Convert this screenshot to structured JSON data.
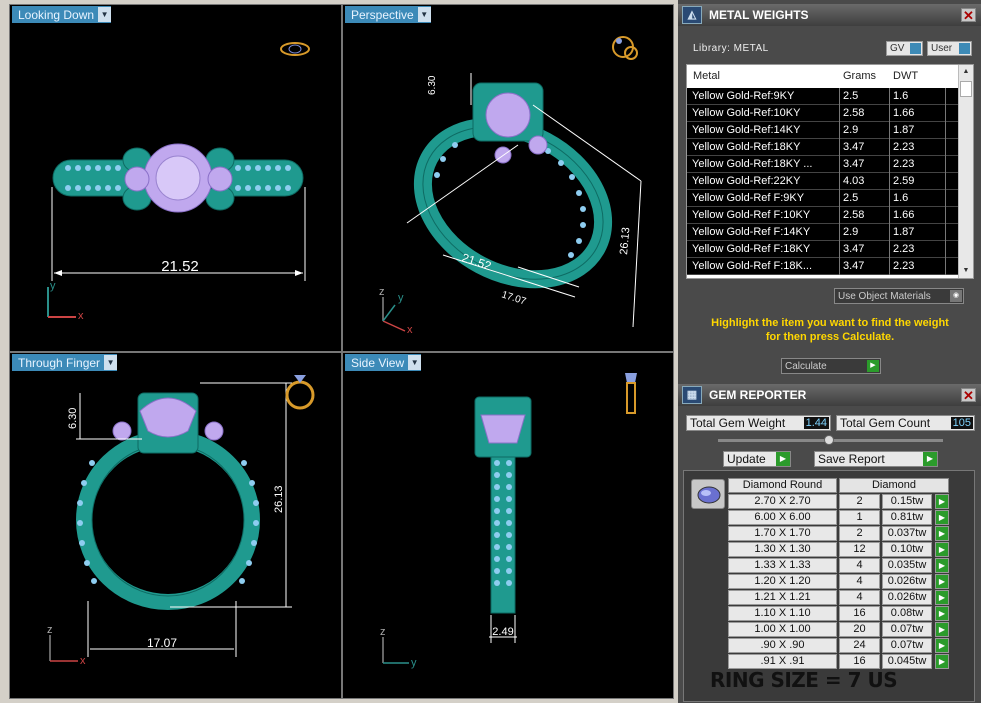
{
  "viewports": {
    "looking_down": {
      "label": "Looking Down",
      "dim_width": "21.52",
      "axis_v": "y",
      "axis_h": "x"
    },
    "perspective": {
      "label": "Perspective",
      "dim_top": "6.30",
      "dim_width": "21.52",
      "dim_height": "26.13",
      "dim_inner": "17.07",
      "axis_v": "z",
      "axis_d": "y",
      "axis_h": "x"
    },
    "through_finger": {
      "label": "Through Finger",
      "dim_top": "6.30",
      "dim_height": "26.13",
      "dim_inner": "17.07",
      "axis_v": "z",
      "axis_h": "x"
    },
    "side_view": {
      "label": "Side View",
      "dim_shank": "2.49",
      "axis_v": "z",
      "axis_h": "y"
    }
  },
  "metal_weights": {
    "title": "METAL WEIGHTS",
    "library_label": "Library: METAL",
    "toggle_gv": "GV",
    "toggle_user": "User",
    "columns": [
      "Metal",
      "Grams",
      "DWT"
    ],
    "rows": [
      [
        "Yellow Gold-Ref:9KY",
        "2.5",
        "1.6"
      ],
      [
        "Yellow Gold-Ref:10KY",
        "2.58",
        "1.66"
      ],
      [
        "Yellow Gold-Ref:14KY",
        "2.9",
        "1.87"
      ],
      [
        "Yellow Gold-Ref:18KY",
        "3.47",
        "2.23"
      ],
      [
        "Yellow Gold-Ref:18KY ...",
        "3.47",
        "2.23"
      ],
      [
        "Yellow Gold-Ref:22KY",
        "4.03",
        "2.59"
      ],
      [
        "Yellow Gold-Ref F:9KY",
        "2.5",
        "1.6"
      ],
      [
        "Yellow Gold-Ref F:10KY",
        "2.58",
        "1.66"
      ],
      [
        "Yellow Gold-Ref F:14KY",
        "2.9",
        "1.87"
      ],
      [
        "Yellow Gold-Ref F:18KY",
        "3.47",
        "2.23"
      ],
      [
        "Yellow Gold-Ref F:18K...",
        "3.47",
        "2.23"
      ]
    ],
    "use_object_materials": "Use Object Materials",
    "hint_line1": "Highlight the item you want to find the weight",
    "hint_line2": "for then press Calculate.",
    "calculate": "Calculate"
  },
  "gem_reporter": {
    "title": "GEM REPORTER",
    "total_weight_label": "Total Gem Weight",
    "total_weight_value": "1.44",
    "total_count_label": "Total Gem Count",
    "total_count_value": "105",
    "update_label": "Update",
    "save_report_label": "Save Report",
    "col_shape": "Diamond Round",
    "col_material": "Diamond",
    "rows": [
      [
        "2.70 X 2.70",
        "2",
        "0.15tw"
      ],
      [
        "6.00 X 6.00",
        "1",
        "0.81tw"
      ],
      [
        "1.70 X 1.70",
        "2",
        "0.037tw"
      ],
      [
        "1.30 X 1.30",
        "12",
        "0.10tw"
      ],
      [
        "1.33 X 1.33",
        "4",
        "0.035tw"
      ],
      [
        "1.20 X 1.20",
        "4",
        "0.026tw"
      ],
      [
        "1.21 X 1.21",
        "4",
        "0.026tw"
      ],
      [
        "1.10 X 1.10",
        "16",
        "0.08tw"
      ],
      [
        "1.00 X 1.00",
        "20",
        "0.07tw"
      ],
      [
        ".90 X .90",
        "24",
        "0.07tw"
      ],
      [
        ".91 X .91",
        "16",
        "0.045tw"
      ]
    ]
  },
  "ring_size": "RING SIZE = 7 US",
  "colors": {
    "metal": "#1f9a8f",
    "stone": "#8ecdf0",
    "hint": "#ffd700",
    "go": "#2b9b2b"
  }
}
